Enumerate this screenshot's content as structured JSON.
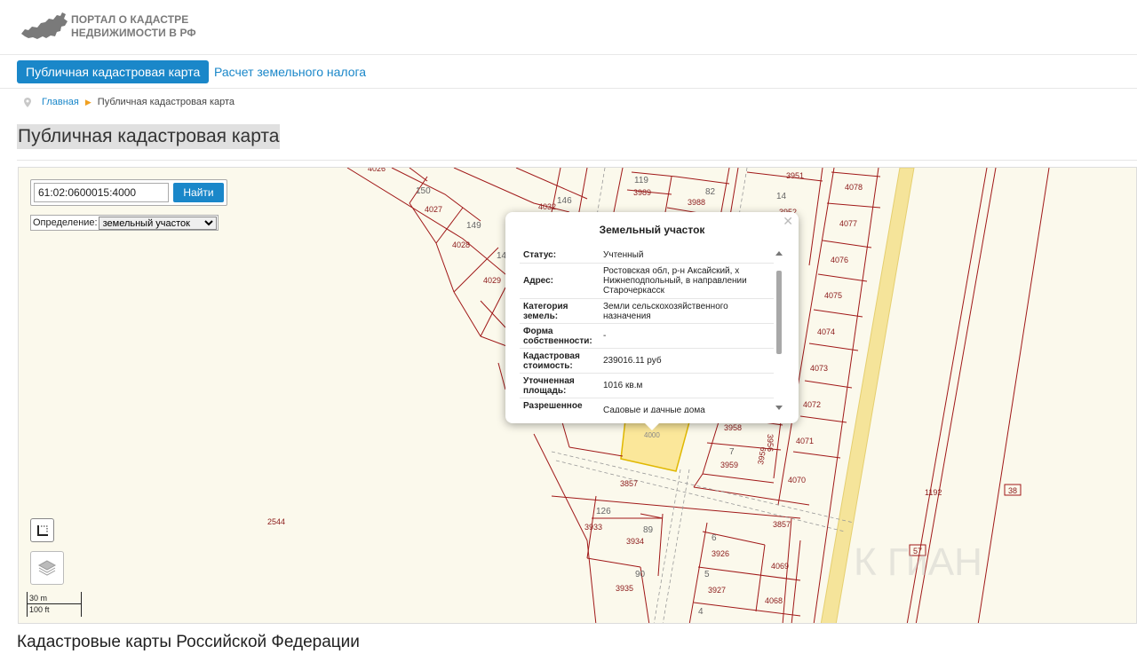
{
  "header": {
    "logo_line1": "ПОРТАЛ О КАДАСТРЕ",
    "logo_line2": "НЕДВИЖИМОСТИ В РФ"
  },
  "nav": {
    "tabs": [
      {
        "label": "Публичная кадастровая карта",
        "active": true
      },
      {
        "label": "Расчет земельного налога",
        "active": false
      }
    ]
  },
  "breadcrumb": {
    "home": "Главная",
    "current": "Публичная кадастровая карта"
  },
  "page_title": "Публичная кадастровая карта",
  "map": {
    "search": {
      "value": "61:02:0600015:4000",
      "button": "Найти"
    },
    "definition": {
      "label": "Определение:",
      "selected": "земельный участок"
    },
    "scale": {
      "metric": "30 m",
      "imperial": "100 ft"
    },
    "watermark": "К ГиАН",
    "parcel_labels": [
      "4026",
      "150",
      "4027",
      "4028",
      "149",
      "4029",
      "14",
      "146",
      "4032",
      "119",
      "3989",
      "82",
      "3988",
      "3951",
      "14",
      "3952",
      "4078",
      "4077",
      "4076",
      "4075",
      "4074",
      "4073",
      "4072",
      "4071",
      "4070",
      "3958",
      "3956",
      "7",
      "3959",
      "3959",
      "3857",
      "3857",
      "126",
      "3933",
      "89",
      "3934",
      "90",
      "3935",
      "6",
      "3926",
      "5",
      "3927",
      "4",
      "4069",
      "4068",
      "4000",
      "2544",
      "1192",
      "38",
      "57"
    ],
    "colors": {
      "boundary": "#a01818",
      "road": "#f5e49a",
      "selected_parcel": "#fbe79a",
      "background": "#fbf9ec"
    }
  },
  "popup": {
    "title": "Земельный участок",
    "rows": [
      {
        "key": "Статус:",
        "value": "Учтенный"
      },
      {
        "key": "Адрес:",
        "value": "Ростовская обл, р-н Аксайский, х Нижнеподпольный, в направлении Старочеркасск"
      },
      {
        "key": "Категория земель:",
        "value": "Земли сельскохозяйственного назначения"
      },
      {
        "key": "Форма собственности:",
        "value": "-"
      },
      {
        "key": "Кадастровая стоимость:",
        "value": "239016.11 руб"
      },
      {
        "key": "Уточненная площадь:",
        "value": "1016 кв.м"
      },
      {
        "key": "Разрешенное использование:",
        "value": "Садовые и дачные дома"
      }
    ]
  },
  "bottom_title": "Кадастровые карты Российской Федерации",
  "icons": [
    "russia-map-logo-icon",
    "map-pin-icon",
    "chevron-right-icon",
    "close-icon",
    "selection-icon",
    "layers-icon",
    "scroll-up-icon",
    "scroll-down-icon"
  ]
}
